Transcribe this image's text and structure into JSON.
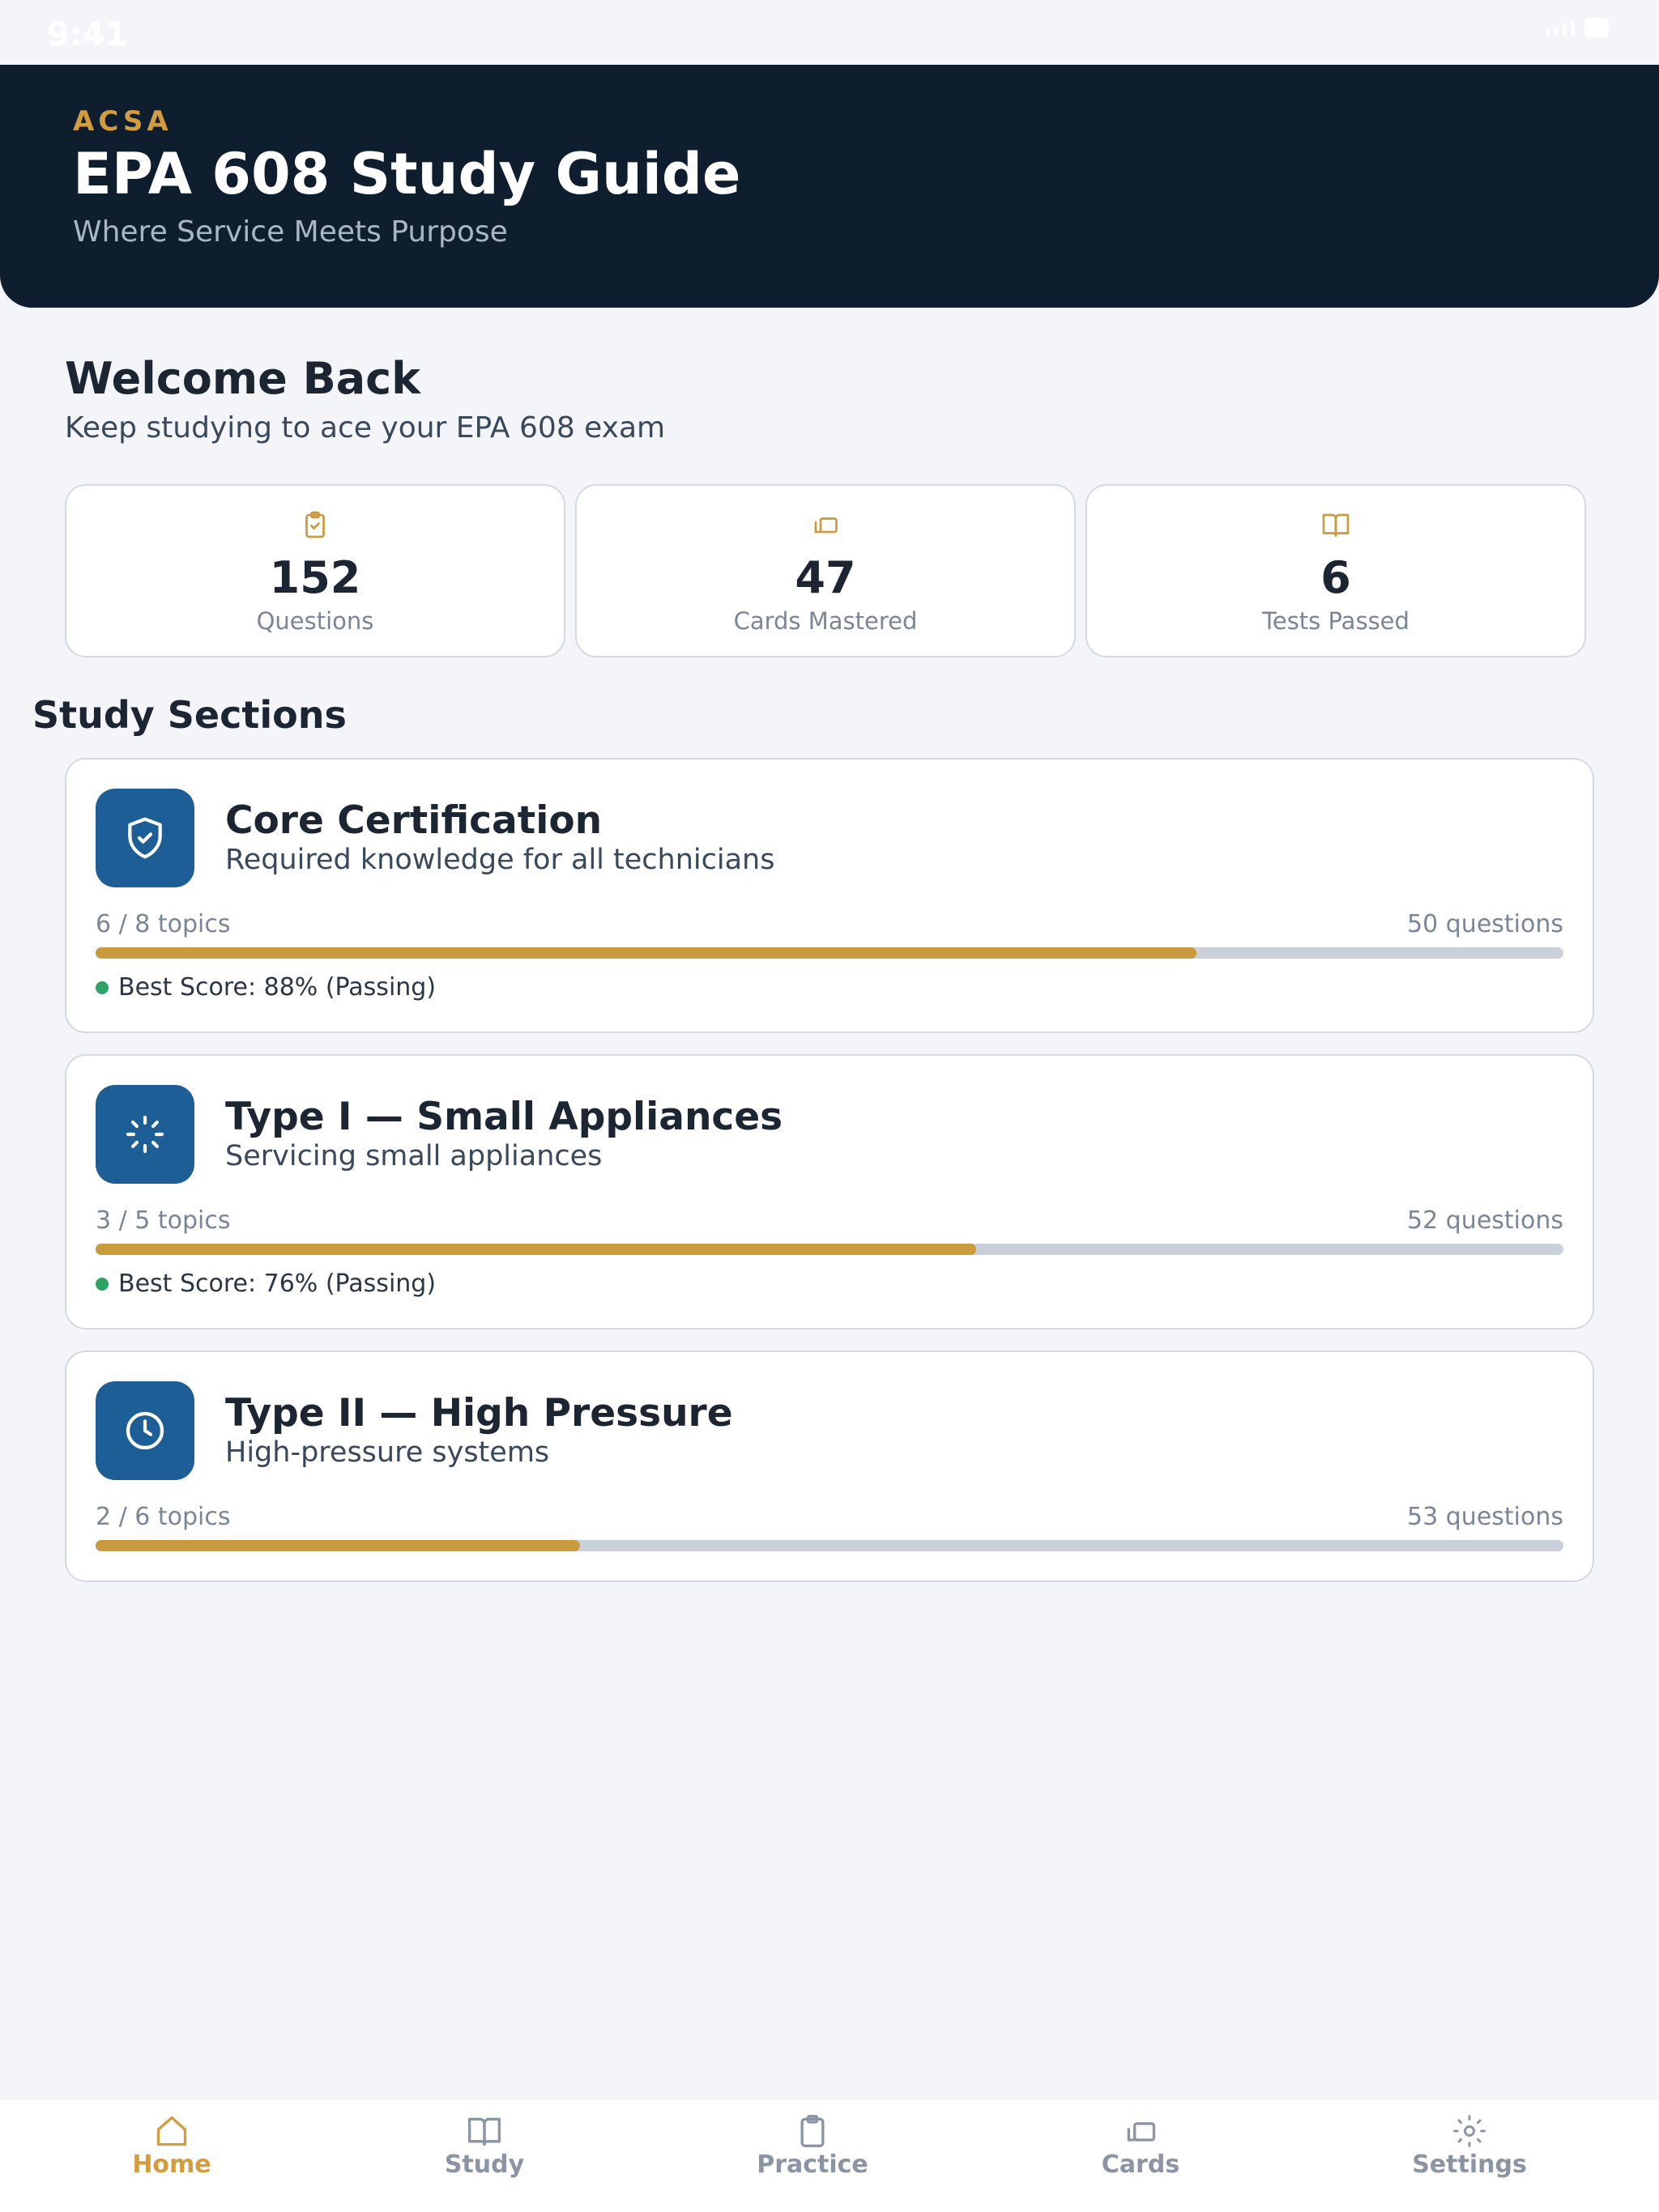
{
  "status_bar": {
    "time": "9:41"
  },
  "header": {
    "brand": "ACSA",
    "title": "EPA 608 Study Guide",
    "tagline": "Where Service Meets Purpose"
  },
  "welcome": {
    "title": "Welcome Back",
    "subtitle": "Keep studying to ace your EPA 608 exam"
  },
  "stats": [
    {
      "icon": "clipboard-check-icon",
      "value": "152",
      "label": "Questions"
    },
    {
      "icon": "cards-icon",
      "value": "47",
      "label": "Cards Mastered"
    },
    {
      "icon": "book-open-icon",
      "value": "6",
      "label": "Tests Passed"
    }
  ],
  "section_heading": "Study Sections",
  "sections": [
    {
      "icon": "shield-check-icon",
      "title": "Core Certification",
      "subtitle": "Required knowledge for all technicians",
      "topics": "6 / 8 topics",
      "questions": "50 questions",
      "progress": 0.75,
      "best_score": "Best Score: 88% (Passing)"
    },
    {
      "icon": "loader-icon",
      "title": "Type I — Small Appliances",
      "subtitle": "Servicing small appliances",
      "topics": "3 / 5 topics",
      "questions": "52 questions",
      "progress": 0.6,
      "best_score": "Best Score: 76% (Passing)"
    },
    {
      "icon": "clock-icon",
      "title": "Type II — High Pressure",
      "subtitle": "High-pressure systems",
      "topics": "2 / 6 topics",
      "questions": "53 questions",
      "progress": 0.33,
      "best_score": ""
    }
  ],
  "nav": [
    {
      "label": "Home",
      "icon": "home-icon",
      "active": true
    },
    {
      "label": "Study",
      "icon": "book-open-icon",
      "active": false
    },
    {
      "label": "Practice",
      "icon": "clipboard-icon",
      "active": false
    },
    {
      "label": "Cards",
      "icon": "cards-icon",
      "active": false
    },
    {
      "label": "Settings",
      "icon": "gear-icon",
      "active": false
    }
  ],
  "colors": {
    "header_bg": "#0f1e2f",
    "accent_gold": "#d39d3f",
    "icon_blue": "#1d5e96",
    "progress_fill": "#c99a3e",
    "passing_green": "#2fa363"
  }
}
